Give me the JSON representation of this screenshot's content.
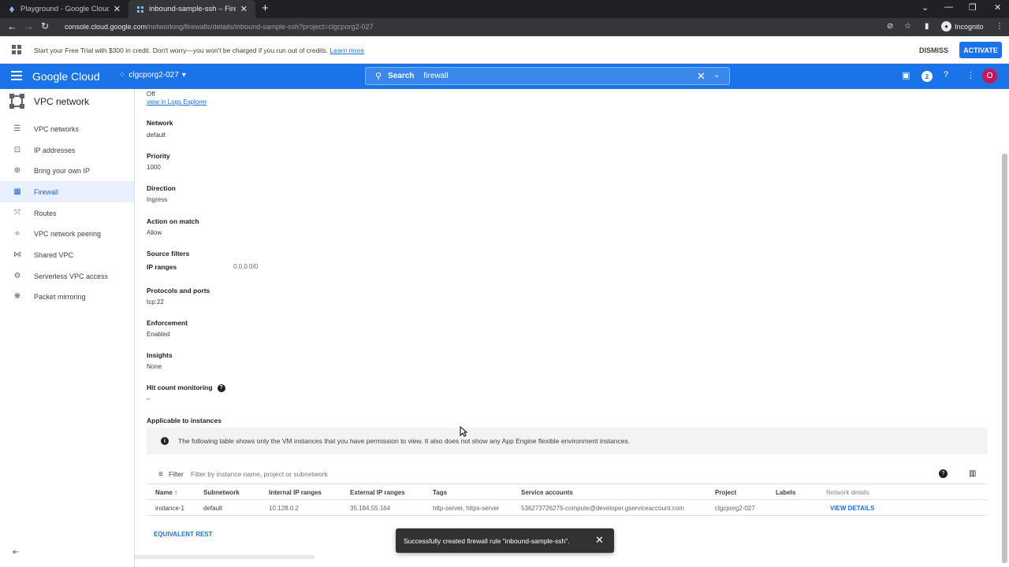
{
  "browser": {
    "tabs": [
      {
        "title": "Playground - Google Cloud Platf",
        "active": false
      },
      {
        "title": "inbound-sample-ssh – Firewall ru",
        "active": true
      }
    ],
    "url_host": "console.cloud.google.com",
    "url_path": "/networking/firewalls/details/inbound-sample-ssh?project=clgcporg2-027",
    "incognito_label": "Incognito"
  },
  "banner": {
    "message": "Start your Free Trial with $300 in credit. Don't worry—you won't be charged if you run out of credits.",
    "learn_more": "Learn more",
    "dismiss": "DISMISS",
    "activate": "ACTIVATE"
  },
  "header": {
    "logo": "Google Cloud",
    "project": "clgcporg2-027",
    "search_label": "Search",
    "search_value": "firewall",
    "notification_count": "2",
    "avatar_letter": "O"
  },
  "sidebar": {
    "title": "VPC network",
    "items": [
      {
        "label": "VPC networks",
        "icon": "network-icon"
      },
      {
        "label": "IP addresses",
        "icon": "ip-icon"
      },
      {
        "label": "Bring your own IP",
        "icon": "globe-icon"
      },
      {
        "label": "Firewall",
        "icon": "firewall-icon",
        "active": true
      },
      {
        "label": "Routes",
        "icon": "routes-icon"
      },
      {
        "label": "VPC network peering",
        "icon": "peering-icon"
      },
      {
        "label": "Shared VPC",
        "icon": "shared-icon"
      },
      {
        "label": "Serverless VPC access",
        "icon": "serverless-icon"
      },
      {
        "label": "Packet mirroring",
        "icon": "mirroring-icon"
      }
    ]
  },
  "details": {
    "logs_value": "Off",
    "logs_link": "view in Logs Explorer",
    "network_label": "Network",
    "network_value": "default",
    "priority_label": "Priority",
    "priority_value": "1000",
    "direction_label": "Direction",
    "direction_value": "Ingress",
    "action_label": "Action on match",
    "action_value": "Allow",
    "source_filters_label": "Source filters",
    "ip_ranges_label": "IP ranges",
    "ip_ranges_value": "0.0.0.0/0",
    "protocols_label": "Protocols and ports",
    "protocols_value": "tcp:22",
    "enforcement_label": "Enforcement",
    "enforcement_value": "Enabled",
    "insights_label": "Insights",
    "insights_value": "None",
    "hit_count_label": "Hit count monitoring",
    "hit_count_value": "–",
    "applicable_label": "Applicable to instances"
  },
  "info_message": "The following table shows only the VM instances that you have permission to view. It also does not show any App Engine flexible environment instances.",
  "table": {
    "filter_label": "Filter",
    "filter_placeholder": "Filter by instance name, project or subnetwork",
    "columns": [
      "Name",
      "Subnetwork",
      "Internal IP ranges",
      "External IP ranges",
      "Tags",
      "Service accounts",
      "Project",
      "Labels",
      "Network details"
    ],
    "rows": [
      {
        "name": "instance-1",
        "subnetwork": "default",
        "internal_ip": "10.128.0.2",
        "external_ip": "35.184.55.164",
        "tags": "http-server, https-server",
        "service_account": "536273726275-compute@developer.gserviceaccount.com",
        "project": "clgcporg2-027",
        "labels": "",
        "network_details": "VIEW DETAILS"
      }
    ]
  },
  "equivalent_rest": "EQUIVALENT REST",
  "toast": {
    "message": "Successfully created firewall rule \"inbound-sample-ssh\"."
  },
  "colors": {
    "brand": "#1a73e8",
    "active_nav_bg": "#e8f0fe",
    "toast_bg": "#323232"
  }
}
